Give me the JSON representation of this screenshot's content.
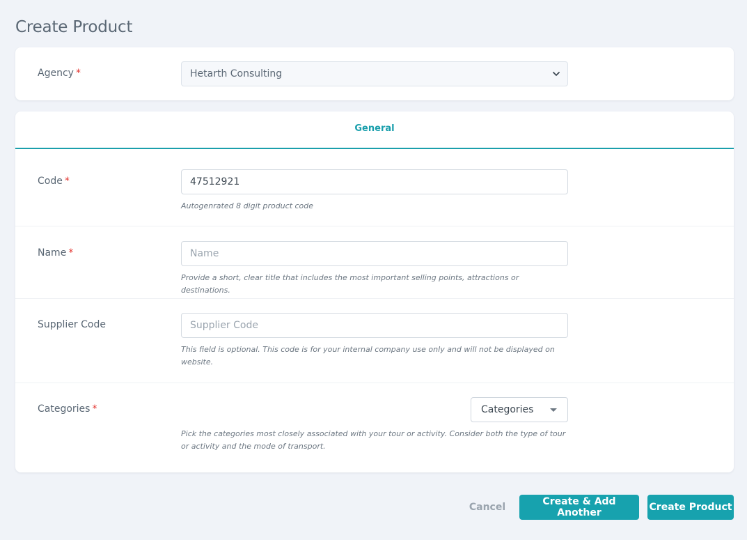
{
  "page": {
    "title": "Create Product"
  },
  "agency": {
    "label": "Agency",
    "required_mark": "*",
    "selected": "Hetarth Consulting"
  },
  "tabs": [
    {
      "label": "General",
      "active": true
    }
  ],
  "fields": {
    "code": {
      "label": "Code",
      "required_mark": "*",
      "value": "47512921",
      "help": "Autogenrated 8 digit product code"
    },
    "name": {
      "label": "Name",
      "required_mark": "*",
      "value": "",
      "placeholder": "Name",
      "help": "Provide a short, clear title that includes the most important selling points, attractions or destinations."
    },
    "supplier_code": {
      "label": "Supplier Code",
      "value": "",
      "placeholder": "Supplier Code",
      "help": "This field is optional. This code is for your internal company use only and will not be displayed on website."
    },
    "categories": {
      "label": "Categories",
      "required_mark": "*",
      "selected": "Categories",
      "help": "Pick the categories most closely associated with your tour or activity. Consider both the type of tour or activity and the mode of transport."
    }
  },
  "actions": {
    "cancel": "Cancel",
    "create_add_another": "Create & Add Another",
    "create": "Create Product"
  },
  "colors": {
    "accent": "#17a2ae",
    "required": "#e3342f",
    "background": "#f0f3f8"
  },
  "icons": {
    "agency_dropdown": "chevron-down-icon",
    "categories_dropdown": "caret-down-icon"
  }
}
